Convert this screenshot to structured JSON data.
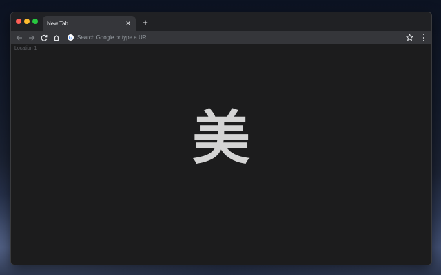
{
  "browser": {
    "tab": {
      "title": "New Tab",
      "close_symbol": "✕"
    },
    "new_tab_symbol": "+",
    "omnibox": {
      "placeholder": "Search Google or type a URL",
      "icon": "google-g-icon"
    },
    "toolbar_icons": [
      "back-arrow-icon",
      "forward-arrow-icon",
      "reload-icon",
      "home-icon",
      "bookmark-star-icon",
      "kebab-menu-icon"
    ]
  },
  "page": {
    "location_label": "Location 1",
    "character": "美"
  },
  "colors": {
    "window_bg": "#1c1d1f",
    "tab_bg": "#35363a",
    "titlebar_bg": "#202124",
    "text_primary": "#e8eaed",
    "text_muted": "#9aa0a6",
    "glyph_color": "#d4d4d4",
    "close_dot": "#ff5f57",
    "minimize_dot": "#febc2e",
    "maximize_dot": "#28c840"
  }
}
